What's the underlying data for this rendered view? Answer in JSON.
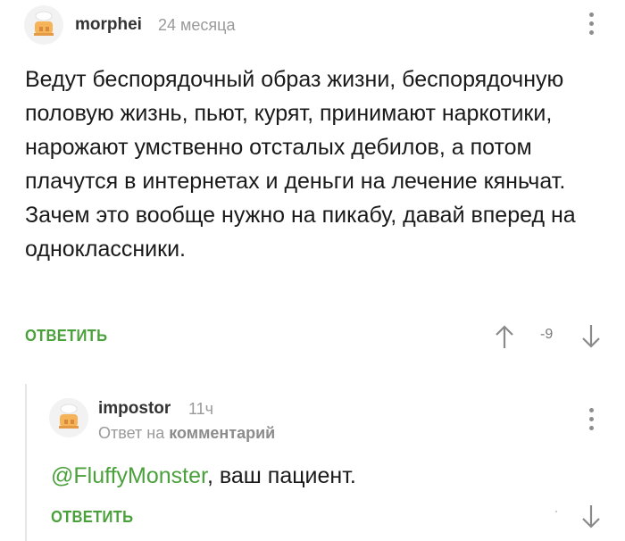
{
  "comments": [
    {
      "username": "morphei",
      "time": "24 месяца",
      "text": "Ведут беспорядочный образ жизни, беспорядочную половую жизнь, пьют, курят, принимают наркотики, нарожают умственно отсталых дебилов, а потом плачутся в интернетах и деньги на лечение кяньчат. Зачем это вообще нужно на пикабу, давай вперед на одноклассники.",
      "reply_label": "ОТВЕТИТЬ",
      "rating": "-9",
      "icons": [
        "avatar",
        "kebab-menu-icon",
        "arrow-up-icon",
        "arrow-down-icon"
      ]
    },
    {
      "username": "impostor",
      "time": "11ч",
      "reply_prefix": "Ответ на",
      "reply_target": "комментарий",
      "mention": "@FluffyMonster",
      "text_rest": ", ваш пациент.",
      "reply_label": "ОТВЕТИТЬ",
      "icons": [
        "avatar",
        "kebab-menu-icon",
        "arrow-down-icon"
      ]
    }
  ],
  "colors": {
    "accent_green": "#4aa13b",
    "muted": "#9a9a9a"
  }
}
